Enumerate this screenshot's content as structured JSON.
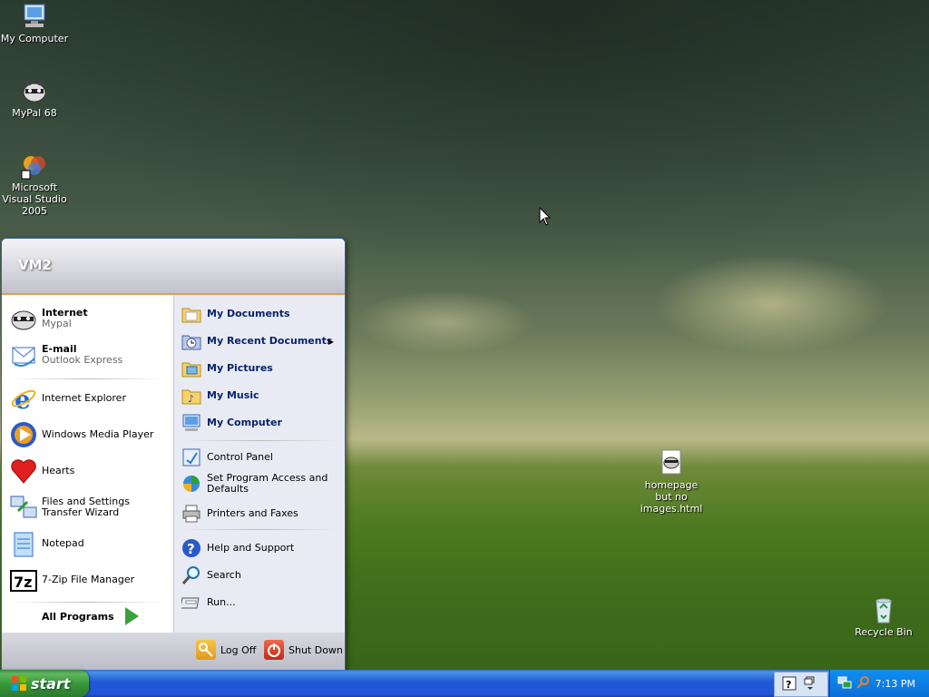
{
  "desktop": {
    "icons": [
      {
        "label": "My Computer"
      },
      {
        "label": "MyPal 68"
      },
      {
        "label": "Microsoft Visual Studio 2005"
      },
      {
        "label": "homepage but no images.html"
      },
      {
        "label": "Recycle Bin"
      }
    ]
  },
  "start_menu": {
    "user": "VM2",
    "pinned": [
      {
        "title": "Internet",
        "subtitle": "Mypal"
      },
      {
        "title": "E-mail",
        "subtitle": "Outlook Express"
      }
    ],
    "recent": [
      {
        "label": "Internet Explorer"
      },
      {
        "label": "Windows Media Player"
      },
      {
        "label": "Hearts"
      },
      {
        "label": "Files and Settings Transfer Wizard"
      },
      {
        "label": "Notepad"
      },
      {
        "label": "7-Zip File Manager"
      }
    ],
    "all_programs": "All Programs",
    "places": [
      {
        "label": "My Documents"
      },
      {
        "label": "My Recent Documents"
      },
      {
        "label": "My Pictures"
      },
      {
        "label": "My Music"
      },
      {
        "label": "My Computer"
      }
    ],
    "system": [
      {
        "label": "Control Panel"
      },
      {
        "label": "Set Program Access and Defaults"
      },
      {
        "label": "Printers and Faxes"
      }
    ],
    "help": [
      {
        "label": "Help and Support"
      },
      {
        "label": "Search"
      },
      {
        "label": "Run..."
      }
    ],
    "log_off": "Log Off",
    "shut_down": "Shut Down"
  },
  "taskbar": {
    "start_label": "start",
    "clock": "7:13 PM"
  }
}
